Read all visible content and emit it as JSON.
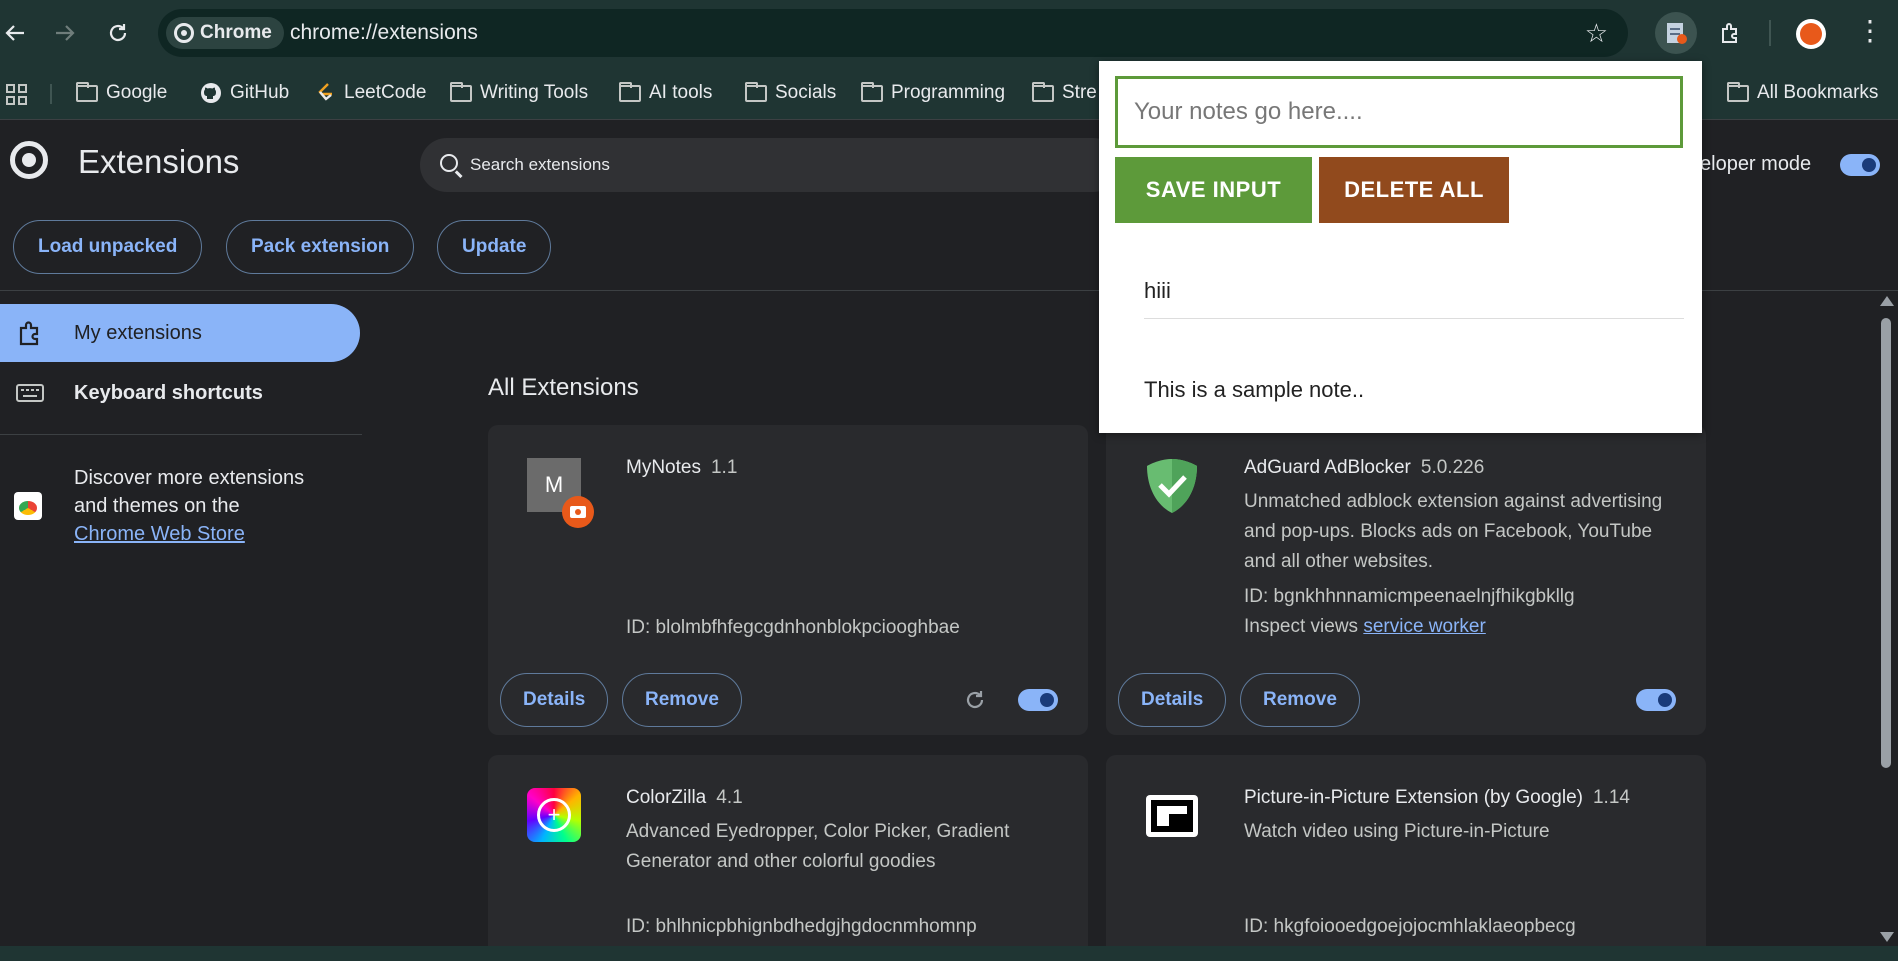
{
  "browser": {
    "chip_label": "Chrome",
    "url": "chrome://extensions"
  },
  "bookmarks": [
    {
      "label": "Google",
      "icon": "folder-icon"
    },
    {
      "label": "GitHub",
      "icon": "github-icon"
    },
    {
      "label": "LeetCode",
      "icon": "leetcode-icon"
    },
    {
      "label": "Writing Tools",
      "icon": "folder-icon"
    },
    {
      "label": "AI tools",
      "icon": "folder-icon"
    },
    {
      "label": "Socials",
      "icon": "folder-icon"
    },
    {
      "label": "Programming",
      "icon": "folder-icon"
    },
    {
      "label": "Stre",
      "icon": "folder-icon"
    }
  ],
  "all_bookmarks_label": "All Bookmarks",
  "page": {
    "title": "Extensions",
    "search_placeholder": "Search extensions",
    "developer_mode_label": "veloper mode",
    "developer_mode_on": true,
    "toolbar_buttons": [
      "Load unpacked",
      "Pack extension",
      "Update"
    ],
    "section_title": "All Extensions"
  },
  "sidebar": {
    "items": [
      {
        "label": "My extensions",
        "icon": "extension-puzzle-icon",
        "active": true
      },
      {
        "label": "Keyboard shortcuts",
        "icon": "keyboard-icon",
        "active": false
      }
    ],
    "discover_text": "Discover more extensions and themes on the",
    "store_link": "Chrome Web Store"
  },
  "extensions": [
    {
      "name": "MyNotes",
      "version": "1.1",
      "description": "",
      "id_text": "ID: blolmbfhfegcgdnhonblokpciooghbae",
      "icon_letter": "M",
      "details_label": "Details",
      "remove_label": "Remove",
      "enabled": true
    },
    {
      "name": "AdGuard AdBlocker",
      "version": "5.0.226",
      "description": "Unmatched adblock extension against advertising and pop-ups. Blocks ads on Facebook, YouTube and all other websites.",
      "id_text": "ID: bgnkhhnnamicmpeenaelnjfhikgbkllg",
      "inspect_label": "Inspect views",
      "inspect_link": "service worker",
      "details_label": "Details",
      "remove_label": "Remove",
      "enabled": true
    },
    {
      "name": "ColorZilla",
      "version": "4.1",
      "description": "Advanced Eyedropper, Color Picker, Gradient Generator and other colorful goodies",
      "id_text": "ID: bhlhnicpbhignbdhedgjhgdocnmhomnp"
    },
    {
      "name": "Picture-in-Picture Extension (by Google)",
      "version": "1.14",
      "description": "Watch video using Picture-in-Picture",
      "id_text": "ID: hkgfoiooedgoejojocmhlaklaeopbecg"
    }
  ],
  "popup": {
    "input_placeholder": "Your notes go here....",
    "input_value": "",
    "save_label": "SAVE INPUT",
    "delete_label": "DELETE ALL",
    "notes": [
      "hiii",
      "This is a sample note.."
    ],
    "colors": {
      "save": "#5d9a3a",
      "delete": "#914a1d"
    }
  }
}
